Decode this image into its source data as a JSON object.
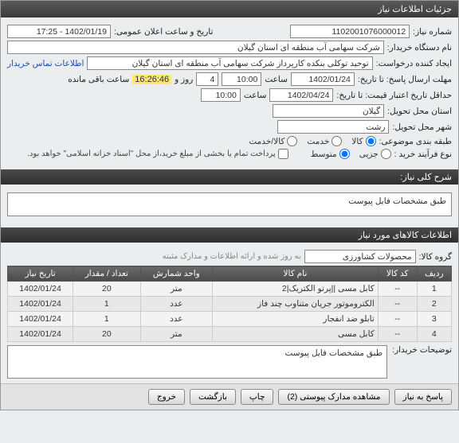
{
  "window": {
    "title": "جزئیات اطلاعات نیاز"
  },
  "fields": {
    "need_number_lbl": "شماره نیاز:",
    "need_number": "1102001076000012",
    "announce_lbl": "تاریخ و ساعت اعلان عمومی:",
    "announce_val": "1402/01/19 - 17:25",
    "buyer_org_lbl": "نام دستگاه خریدار:",
    "buyer_org": "شرکت سهامی آب منطقه ای استان گیلان",
    "requester_lbl": "ایجاد کننده درخواست:",
    "requester": "توحید توکلی بنکده کارپرداز شرکت سهامی آب منطقه ای استان گیلان",
    "contact_link": "اطلاعات تماس خریدار",
    "deadline_lbl": "مهلت ارسال پاسخ: تا تاریخ:",
    "deadline_date": "1402/01/24",
    "time_lbl": "ساعت",
    "deadline_time": "10:00",
    "days_lbl": "4",
    "days_unit": "روز و",
    "countdown": "16:26:46",
    "remain_lbl": "ساعت باقی مانده",
    "validity_lbl": "حداقل تاریخ اعتبار قیمت: تا تاریخ:",
    "validity_date": "1402/04/24",
    "validity_time": "10:00",
    "province_lbl": "استان محل تحویل:",
    "province": "گیلان",
    "city_lbl": "شهر محل تحویل:",
    "city": "رشت",
    "class_lbl": "طبقه بندی موضوعی:",
    "class_goods": "کالا",
    "class_service": "خدمت",
    "class_both": "کالا/خدمت",
    "process_lbl": "نوع فرآیند خرید :",
    "process_small": "جزیی",
    "process_medium": "متوسط",
    "pay_text": "پرداخت تمام یا بخشی از مبلغ خرید،از محل \"اسناد خزانه اسلامی\" خواهد بود.",
    "desc_header": "شرح کلی نیاز:",
    "desc_text": "طبق مشخصات فایل پیوست",
    "items_header": "اطلاعات کالاهای مورد نیاز",
    "group_lbl": "گروه کالا:",
    "group_val": "محصولات کشاورزی",
    "group_sub": "به روز شده و ارائه اطلاعات و مدارک مثبته",
    "buyer_notes_lbl": "توضیحات خریدار:",
    "buyer_notes": "طبق مشخصات فایل پیوست"
  },
  "table": {
    "headers": [
      "ردیف",
      "کد کالا",
      "نام کالا",
      "واحد شمارش",
      "تعداد / مقدار",
      "تاریخ نیاز"
    ],
    "rows": [
      {
        "n": "1",
        "code": "--",
        "name": "کابل مسی ||پرتو الکتریک|2",
        "unit": "متر",
        "qty": "20",
        "date": "1402/01/24"
      },
      {
        "n": "2",
        "code": "--",
        "name": "الکتروموتور جریان متناوب چند فاز",
        "unit": "عدد",
        "qty": "1",
        "date": "1402/01/24"
      },
      {
        "n": "3",
        "code": "--",
        "name": "تابلو ضد انفجار",
        "unit": "عدد",
        "qty": "1",
        "date": "1402/01/24"
      },
      {
        "n": "4",
        "code": "--",
        "name": "کابل مسی",
        "unit": "متر",
        "qty": "20",
        "date": "1402/01/24"
      }
    ]
  },
  "buttons": {
    "respond": "پاسخ به نیاز",
    "attachments": "مشاهده مدارک پیوستی (2)",
    "print": "چاپ",
    "back": "بازگشت",
    "exit": "خروج"
  }
}
